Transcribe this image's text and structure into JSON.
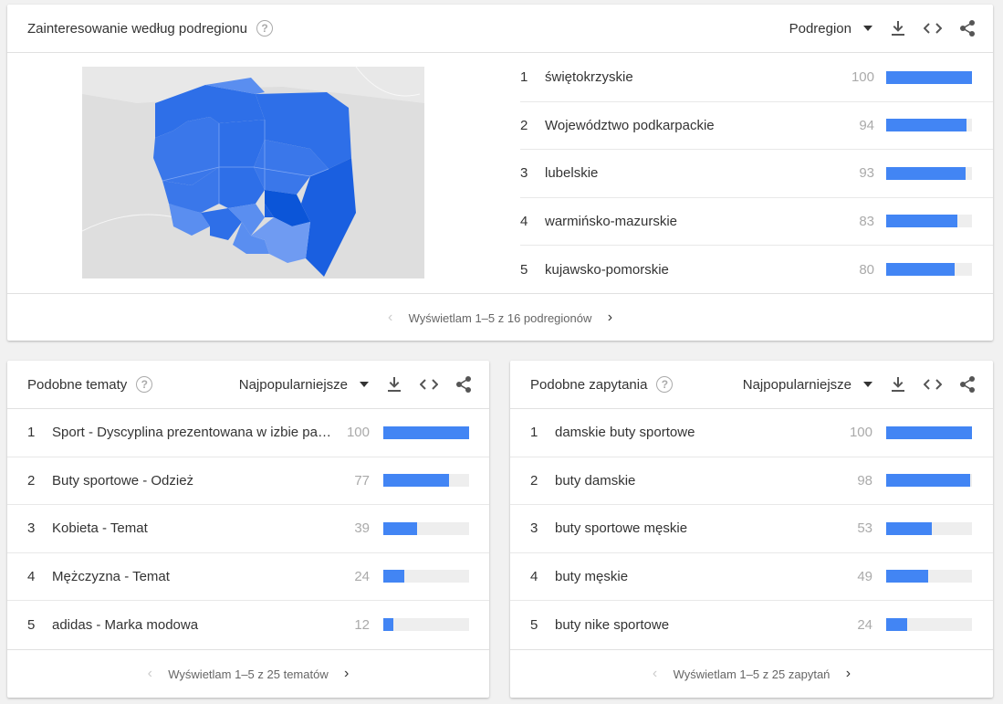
{
  "region": {
    "title": "Zainteresowanie według podregionu",
    "dropdown": "Podregion",
    "items": [
      {
        "rank": "1",
        "label": "świętokrzyskie",
        "value": 100
      },
      {
        "rank": "2",
        "label": "Województwo podkarpackie",
        "value": 94
      },
      {
        "rank": "3",
        "label": "lubelskie",
        "value": 93
      },
      {
        "rank": "4",
        "label": "warmińsko-mazurskie",
        "value": 83
      },
      {
        "rank": "5",
        "label": "kujawsko-pomorskie",
        "value": 80
      }
    ],
    "pager": "Wyświetlam 1–5 z 16 podregionów"
  },
  "topics": {
    "title": "Podobne tematy",
    "dropdown": "Najpopularniejsze",
    "items": [
      {
        "rank": "1",
        "label": "Sport - Dyscyplina prezentowana w izbie pamięci",
        "value": 100
      },
      {
        "rank": "2",
        "label": "Buty sportowe - Odzież",
        "value": 77
      },
      {
        "rank": "3",
        "label": "Kobieta - Temat",
        "value": 39
      },
      {
        "rank": "4",
        "label": "Mężczyzna - Temat",
        "value": 24
      },
      {
        "rank": "5",
        "label": "adidas - Marka modowa",
        "value": 12
      }
    ],
    "pager": "Wyświetlam 1–5 z 25 tematów"
  },
  "queries": {
    "title": "Podobne zapytania",
    "dropdown": "Najpopularniejsze",
    "items": [
      {
        "rank": "1",
        "label": "damskie buty sportowe",
        "value": 100
      },
      {
        "rank": "2",
        "label": "buty damskie",
        "value": 98
      },
      {
        "rank": "3",
        "label": "buty sportowe męskie",
        "value": 53
      },
      {
        "rank": "4",
        "label": "buty męskie",
        "value": 49
      },
      {
        "rank": "5",
        "label": "buty nike sportowe",
        "value": 24
      }
    ],
    "pager": "Wyświetlam 1–5 z 25 zapytań"
  },
  "icons": {
    "help": "?",
    "download": "download-icon",
    "embed": "embed-icon",
    "share": "share-icon",
    "prev": "‹",
    "next": "›"
  },
  "colors": {
    "bar": "#4285f4",
    "track": "#eeeeee",
    "map_strong": "#1a5fe0",
    "map_mid": "#2e6fe8",
    "map_light": "#5a8ef0"
  }
}
